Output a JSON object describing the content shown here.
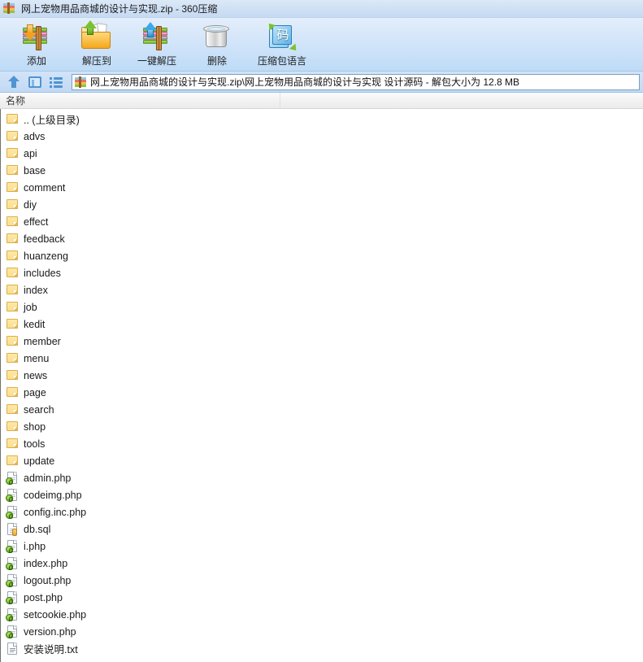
{
  "window": {
    "title": "网上宠物用品商城的设计与实现.zip  -  360压缩",
    "icon": "zip-archive-icon"
  },
  "toolbar": {
    "buttons": [
      {
        "label": "添加",
        "icon": "add-to-archive-icon"
      },
      {
        "label": "解压到",
        "icon": "extract-to-icon"
      },
      {
        "label": "一键解压",
        "icon": "one-click-extract-icon"
      },
      {
        "label": "删除",
        "icon": "delete-trash-icon"
      },
      {
        "label": "压缩包语言",
        "icon": "archive-language-icon",
        "glyph": "码"
      }
    ]
  },
  "addressbar": {
    "up_icon": "up-arrow-icon",
    "panel_icon": "preview-panel-icon",
    "list_icon": "list-view-icon",
    "path_icon": "zip-archive-icon",
    "path": "网上宠物用品商城的设计与实现.zip\\网上宠物用品商城的设计与实现 设计源码 - 解包大小为 12.8 MB"
  },
  "filelist": {
    "columns": [
      "名称"
    ],
    "rows": [
      {
        "name": ".. (上级目录)",
        "type": "parent"
      },
      {
        "name": "advs",
        "type": "folder"
      },
      {
        "name": "api",
        "type": "folder"
      },
      {
        "name": "base",
        "type": "folder"
      },
      {
        "name": "comment",
        "type": "folder"
      },
      {
        "name": "diy",
        "type": "folder"
      },
      {
        "name": "effect",
        "type": "folder"
      },
      {
        "name": "feedback",
        "type": "folder"
      },
      {
        "name": "huanzeng",
        "type": "folder"
      },
      {
        "name": "includes",
        "type": "folder"
      },
      {
        "name": "index",
        "type": "folder"
      },
      {
        "name": "job",
        "type": "folder"
      },
      {
        "name": "kedit",
        "type": "folder"
      },
      {
        "name": "member",
        "type": "folder"
      },
      {
        "name": "menu",
        "type": "folder"
      },
      {
        "name": "news",
        "type": "folder"
      },
      {
        "name": "page",
        "type": "folder"
      },
      {
        "name": "search",
        "type": "folder"
      },
      {
        "name": "shop",
        "type": "folder"
      },
      {
        "name": "tools",
        "type": "folder"
      },
      {
        "name": "update",
        "type": "folder"
      },
      {
        "name": "admin.php",
        "type": "php"
      },
      {
        "name": "codeimg.php",
        "type": "php"
      },
      {
        "name": "config.inc.php",
        "type": "php"
      },
      {
        "name": "db.sql",
        "type": "sql"
      },
      {
        "name": "i.php",
        "type": "php"
      },
      {
        "name": "index.php",
        "type": "php"
      },
      {
        "name": "logout.php",
        "type": "php"
      },
      {
        "name": "post.php",
        "type": "php"
      },
      {
        "name": "setcookie.php",
        "type": "php"
      },
      {
        "name": "version.php",
        "type": "php"
      },
      {
        "name": "安装说明.txt",
        "type": "txt"
      }
    ]
  },
  "colors": {
    "titlebar_gradient_top": "#dce9f7",
    "titlebar_gradient_bottom": "#c6daf2",
    "toolbar_gradient_top": "#e3eefb",
    "toolbar_gradient_bottom": "#bedbf6",
    "addressbar_gradient_top": "#d2e4f8",
    "addressbar_gradient_bottom": "#c2d9f4",
    "list_background": "#ffffff",
    "folder_icon": "#fcdf8c",
    "php_icon_accent": "#76bb2a",
    "nav_icon_blue": "#4f94d4"
  }
}
